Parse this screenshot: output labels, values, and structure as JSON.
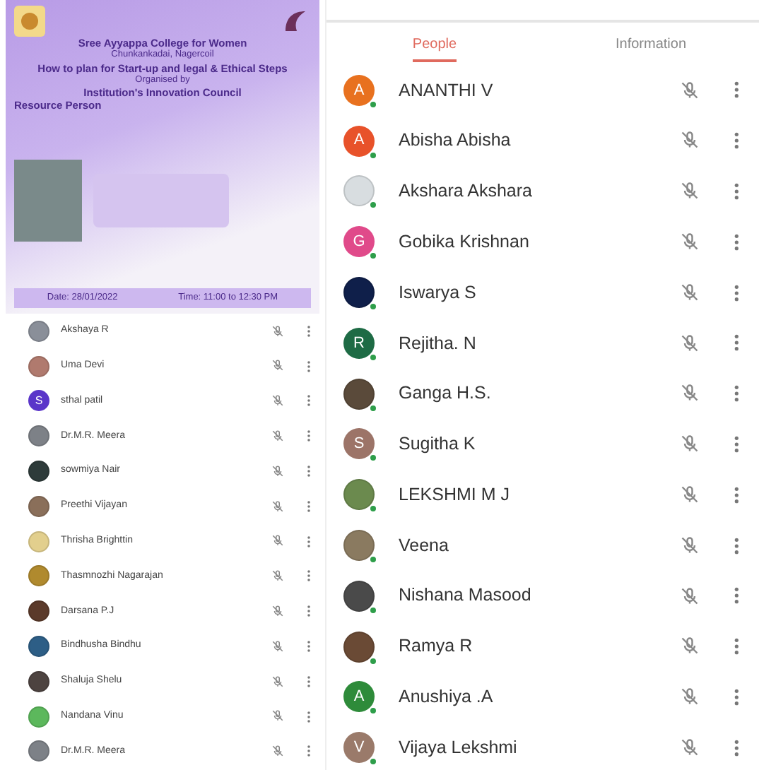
{
  "left_panel": {
    "poster": {
      "college": "Sree Ayyappa College for Women",
      "place": "Chunkankadai, Nagercoil",
      "event": "How to plan for Start-up and legal & Ethical Steps",
      "organised_by": "Organised by",
      "council": "Institution's Innovation Council",
      "resource_heading": "Resource Person",
      "date": "Date: 28/01/2022",
      "time": "Time: 11:00 to 12:30 PM"
    },
    "participants": [
      {
        "name": "Akshaya R",
        "kind": "photo",
        "color": "#8a8f99"
      },
      {
        "name": "Uma Devi",
        "kind": "photo",
        "color": "#b07a6e"
      },
      {
        "name": "sthal patil",
        "kind": "letter",
        "initial": "S",
        "color": "#5a35c9"
      },
      {
        "name": "Dr.M.R. Meera",
        "kind": "photo",
        "color": "#7d8187"
      },
      {
        "name": "sowmiya Nair",
        "kind": "photo",
        "color": "#2e3b3a"
      },
      {
        "name": "Preethi Vijayan",
        "kind": "photo",
        "color": "#8a6f5a"
      },
      {
        "name": "Thrisha Brighttin",
        "kind": "photo",
        "color": "#e2cf8d"
      },
      {
        "name": "Thasmnozhi Nagarajan",
        "kind": "photo",
        "color": "#b08a2e"
      },
      {
        "name": "Darsana P.J",
        "kind": "photo",
        "color": "#5b3a2a"
      },
      {
        "name": "Bindhusha Bindhu",
        "kind": "photo",
        "color": "#2d5e86"
      },
      {
        "name": "Shaluja Shelu",
        "kind": "photo",
        "color": "#4d4340"
      },
      {
        "name": "Nandana Vinu",
        "kind": "photo",
        "color": "#5cb85c"
      },
      {
        "name": "Dr.M.R. Meera",
        "kind": "photo",
        "color": "#7d8187"
      }
    ]
  },
  "right_panel": {
    "tabs": [
      {
        "label": "People",
        "selected": true
      },
      {
        "label": "Information",
        "selected": false
      }
    ],
    "participants": [
      {
        "name": "ANANTHI V",
        "kind": "letter",
        "initial": "A",
        "color": "#e8711f"
      },
      {
        "name": "Abisha Abisha",
        "kind": "letter",
        "initial": "A",
        "color": "#e8522a"
      },
      {
        "name": "Akshara Akshara",
        "kind": "photo",
        "color": "#d8dde0"
      },
      {
        "name": "Gobika Krishnan",
        "kind": "letter",
        "initial": "G",
        "color": "#e04a8a"
      },
      {
        "name": "Iswarya S",
        "kind": "photo",
        "color": "#0f1f4a"
      },
      {
        "name": "Rejitha. N",
        "kind": "letter",
        "initial": "R",
        "color": "#1e6b45"
      },
      {
        "name": "Ganga H.S.",
        "kind": "photo",
        "color": "#5a4a3a"
      },
      {
        "name": "Sugitha K",
        "kind": "letter",
        "initial": "S",
        "color": "#9c7468"
      },
      {
        "name": "LEKSHMI M J",
        "kind": "photo",
        "color": "#6b8a4e"
      },
      {
        "name": "Veena",
        "kind": "photo",
        "color": "#8a7a60"
      },
      {
        "name": "Nishana Masood",
        "kind": "photo",
        "color": "#4a4a4a"
      },
      {
        "name": "Ramya R",
        "kind": "photo",
        "color": "#6a4a35"
      },
      {
        "name": "Anushiya .A",
        "kind": "letter",
        "initial": "A",
        "color": "#2e8b3a"
      },
      {
        "name": "Vijaya Lekshmi",
        "kind": "letter",
        "initial": "V",
        "color": "#9a7a6a"
      }
    ]
  }
}
